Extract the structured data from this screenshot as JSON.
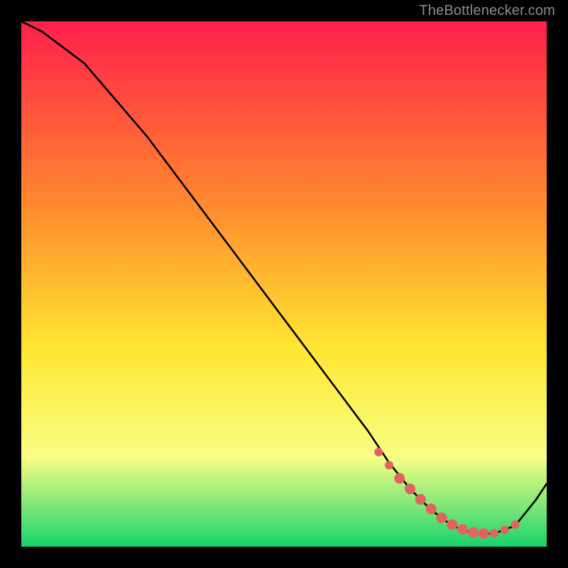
{
  "attribution": "TheBottlenecker.com",
  "colors": {
    "gradient_top": "#ff1f4b",
    "gradient_mid1": "#ff8a2e",
    "gradient_mid2": "#ffe631",
    "gradient_mid3": "#f8ff85",
    "gradient_bottom": "#18d36c",
    "curve": "#000000",
    "marker": "#e4625e"
  },
  "chart_data": {
    "type": "line",
    "title": "",
    "xlabel": "",
    "ylabel": "",
    "xlim": [
      0,
      100
    ],
    "ylim": [
      0,
      100
    ],
    "series": [
      {
        "name": "curve",
        "x": [
          0,
          4,
          8,
          12,
          18,
          24,
          30,
          36,
          42,
          48,
          54,
          60,
          66,
          70,
          74,
          78,
          82,
          86,
          90,
          94,
          98,
          100
        ],
        "y": [
          100,
          98,
          95,
          92,
          85,
          78,
          70,
          62,
          54,
          46,
          38,
          30,
          22,
          16,
          11,
          7,
          4,
          2.5,
          2.5,
          4,
          9,
          12
        ]
      }
    ],
    "markers": {
      "name": "highlighted-points",
      "x": [
        68,
        70,
        72,
        74,
        76,
        78,
        80,
        82,
        84,
        86,
        88,
        90,
        92,
        94
      ],
      "y": [
        18,
        15.5,
        13,
        11,
        9,
        7.2,
        5.5,
        4.2,
        3.3,
        2.7,
        2.5,
        2.6,
        3.2,
        4.2
      ]
    }
  }
}
